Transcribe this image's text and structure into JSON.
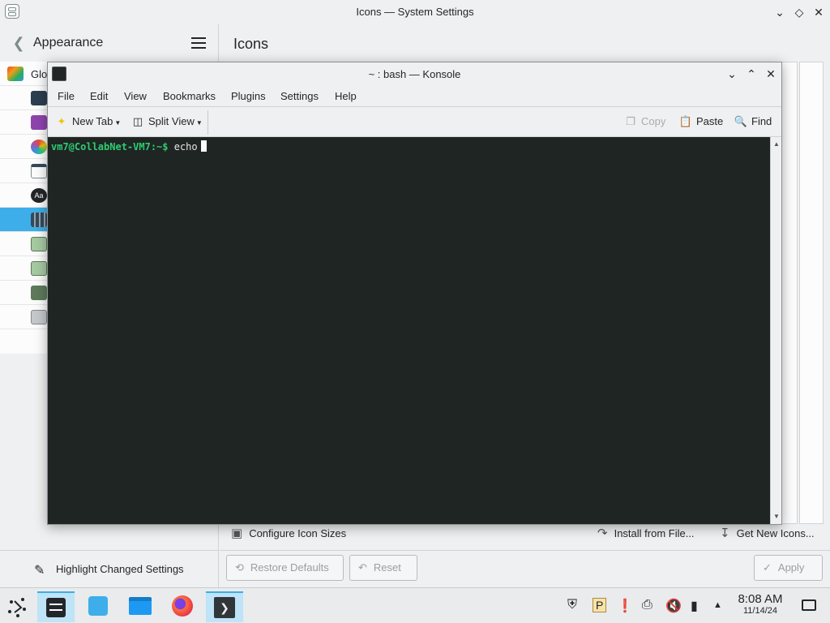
{
  "settings": {
    "window_title": "Icons — System Settings",
    "sidebar_title": "Appearance",
    "page_title": "Icons",
    "nav_items": [
      {
        "label": "Glo",
        "icon": "global-theme-icon",
        "selected": false
      },
      {
        "label": "",
        "icon": "plasma-style-icon",
        "selected": false
      },
      {
        "label": "",
        "icon": "application-style-icon",
        "selected": false
      },
      {
        "label": "",
        "icon": "colors-icon",
        "selected": false
      },
      {
        "label": "",
        "icon": "window-decorations-icon",
        "selected": false
      },
      {
        "label": "",
        "icon": "fonts-icon",
        "selected": false
      },
      {
        "label": "",
        "icon": "icons-icon",
        "selected": true
      },
      {
        "label": "",
        "icon": "cursors-icon",
        "selected": false
      },
      {
        "label": "",
        "icon": "splash-screen-icon",
        "selected": false
      },
      {
        "label": "",
        "icon": "login-screen-icon",
        "selected": false
      },
      {
        "label": "",
        "icon": "gnome-gtk-icon",
        "selected": false
      }
    ],
    "highlight_changed": "Highlight Changed Settings",
    "configure_icon_sizes": "Configure Icon Sizes",
    "install_from_file": "Install from File...",
    "get_new_icons": "Get New Icons...",
    "restore_defaults": "Restore Defaults",
    "reset": "Reset",
    "apply": "Apply"
  },
  "konsole": {
    "window_title": "~ : bash — Konsole",
    "menu": [
      "File",
      "Edit",
      "View",
      "Bookmarks",
      "Plugins",
      "Settings",
      "Help"
    ],
    "toolbar": {
      "new_tab": "New Tab",
      "split_view": "Split View",
      "copy": "Copy",
      "paste": "Paste",
      "find": "Find"
    },
    "terminal": {
      "prompt": "vm7@CollabNet-VM7:~$",
      "command": " echo"
    }
  },
  "taskbar": {
    "time": "8:08 AM",
    "date": "11/14/24"
  },
  "colors": {
    "accent": "#3daee9",
    "terminal_bg": "#1f2523",
    "prompt_green": "#2ecc71"
  }
}
